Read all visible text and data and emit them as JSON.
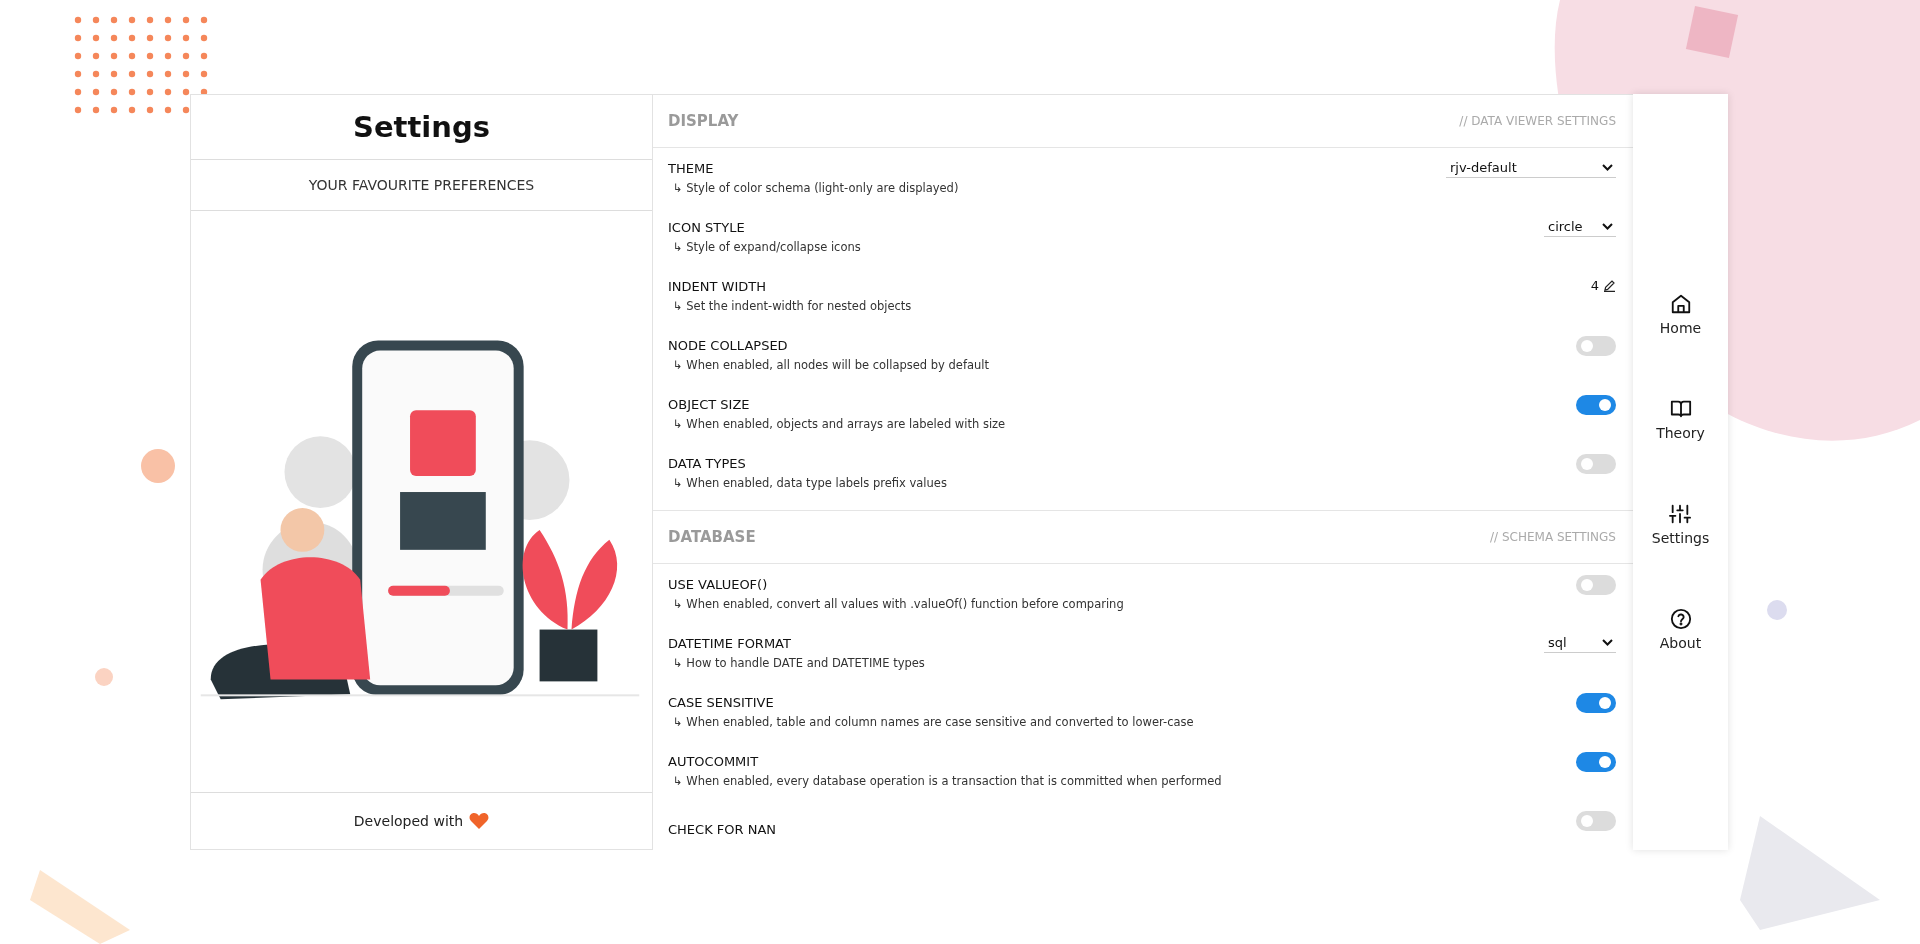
{
  "sidebar": {
    "title": "Settings",
    "subtitle": "YOUR FAVOURITE PREFERENCES",
    "footer": "Developed with"
  },
  "sections": [
    {
      "title": "DISPLAY",
      "note": "// DATA VIEWER SETTINGS",
      "rows": [
        {
          "kind": "select",
          "label": "THEME",
          "description": "↳ Style of color schema (light-only are displayed)",
          "value": "rjv-default"
        },
        {
          "kind": "select",
          "label": "ICON STYLE",
          "description": "↳ Style of expand/collapse icons",
          "value": "circle"
        },
        {
          "kind": "number",
          "label": "INDENT WIDTH",
          "description": "↳ Set the indent-width for nested objects",
          "value": "4"
        },
        {
          "kind": "toggle",
          "label": "NODE COLLAPSED",
          "description": "↳ When enabled, all nodes will be collapsed by default",
          "on": false
        },
        {
          "kind": "toggle",
          "label": "OBJECT SIZE",
          "description": "↳ When enabled, objects and arrays are labeled with size",
          "on": true
        },
        {
          "kind": "toggle",
          "label": "DATA TYPES",
          "description": "↳ When enabled, data type labels prefix values",
          "on": false
        }
      ]
    },
    {
      "title": "DATABASE",
      "note": "// SCHEMA SETTINGS",
      "rows": [
        {
          "kind": "toggle",
          "label": "USE VALUEOF()",
          "description": "↳ When enabled, convert all values with .valueOf() function before comparing",
          "on": false
        },
        {
          "kind": "select",
          "label": "DATETIME FORMAT",
          "description": "↳ How to handle DATE and DATETIME types",
          "value": "sql"
        },
        {
          "kind": "toggle",
          "label": "CASE SENSITIVE",
          "description": "↳ When enabled, table and column names are case sensitive and converted to lower-case",
          "on": true
        },
        {
          "kind": "toggle",
          "label": "AUTOCOMMIT",
          "description": "↳ When enabled, every database operation is a transaction that is committed when performed",
          "on": true
        },
        {
          "kind": "toggle",
          "label": "CHECK FOR NAN",
          "on": false
        }
      ]
    }
  ],
  "nav": [
    {
      "label": "Home"
    },
    {
      "label": "Theory"
    },
    {
      "label": "Settings"
    },
    {
      "label": "About"
    }
  ]
}
